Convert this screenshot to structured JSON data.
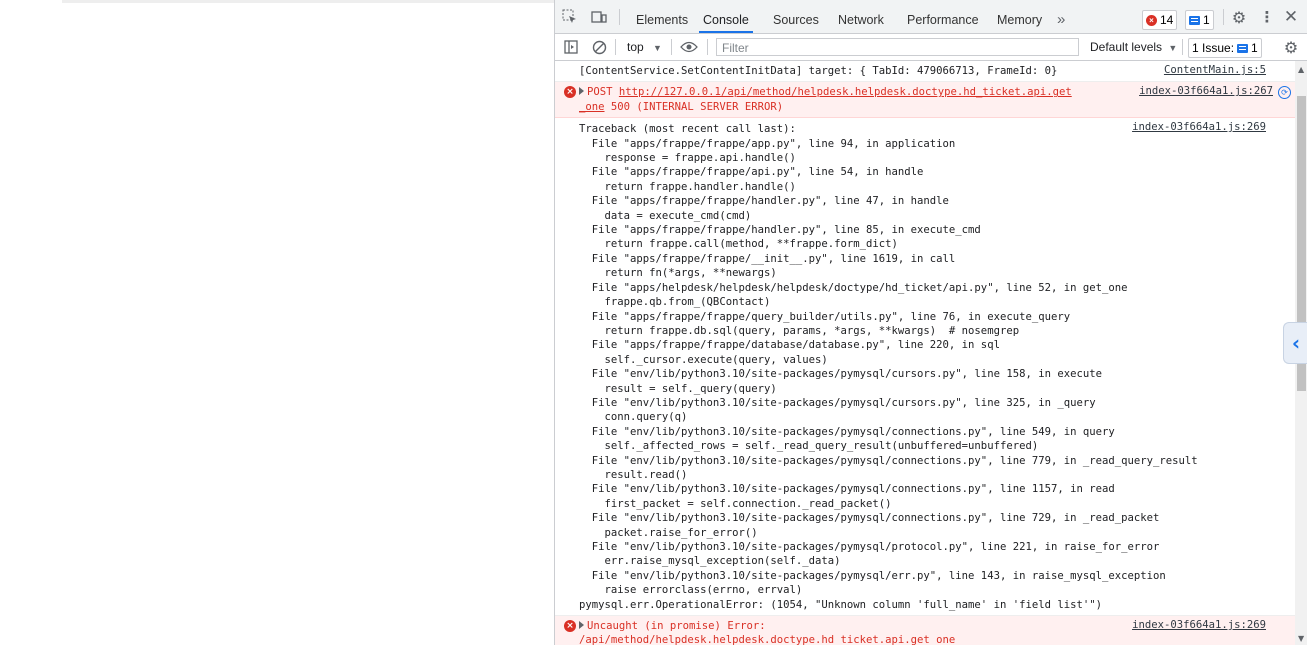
{
  "devtools": {
    "tabs": [
      "Elements",
      "Console",
      "Sources",
      "Network",
      "Performance",
      "Memory"
    ],
    "active_tab": "Console",
    "more_tabs": "»",
    "error_count": "14",
    "message_count": "1",
    "context": "top",
    "filter_placeholder": "Filter",
    "levels": "Default levels",
    "issues_label": "1 Issue:",
    "issues_count": "1"
  },
  "console": {
    "msg1": {
      "text": "[ContentService.SetContentInitData] target: { TabId: 479066713, FrameId: 0}",
      "source": "ContentMain.js:5"
    },
    "msg2": {
      "method": "POST ",
      "url": "http://127.0.0.1/api/method/helpdesk.helpdesk.doctype.hd_ticket.api.get",
      "url_cont": "_one",
      "status": " 500 (INTERNAL SERVER ERROR)",
      "source": "index-03f664a1.js:267"
    },
    "msg3": {
      "source": "index-03f664a1.js:269",
      "lines": [
        "Traceback (most recent call last):",
        "  File \"apps/frappe/frappe/app.py\", line 94, in application",
        "    response = frappe.api.handle()",
        "  File \"apps/frappe/frappe/api.py\", line 54, in handle",
        "    return frappe.handler.handle()",
        "  File \"apps/frappe/frappe/handler.py\", line 47, in handle",
        "    data = execute_cmd(cmd)",
        "  File \"apps/frappe/frappe/handler.py\", line 85, in execute_cmd",
        "    return frappe.call(method, **frappe.form_dict)",
        "  File \"apps/frappe/frappe/__init__.py\", line 1619, in call",
        "    return fn(*args, **newargs)",
        "  File \"apps/helpdesk/helpdesk/helpdesk/doctype/hd_ticket/api.py\", line 52, in get_one",
        "    frappe.qb.from_(QBContact)",
        "  File \"apps/frappe/frappe/query_builder/utils.py\", line 76, in execute_query",
        "    return frappe.db.sql(query, params, *args, **kwargs)  # nosemgrep",
        "  File \"apps/frappe/frappe/database/database.py\", line 220, in sql",
        "    self._cursor.execute(query, values)",
        "  File \"env/lib/python3.10/site-packages/pymysql/cursors.py\", line 158, in execute",
        "    result = self._query(query)",
        "  File \"env/lib/python3.10/site-packages/pymysql/cursors.py\", line 325, in _query",
        "    conn.query(q)",
        "  File \"env/lib/python3.10/site-packages/pymysql/connections.py\", line 549, in query",
        "    self._affected_rows = self._read_query_result(unbuffered=unbuffered)",
        "  File \"env/lib/python3.10/site-packages/pymysql/connections.py\", line 779, in _read_query_result",
        "    result.read()",
        "  File \"env/lib/python3.10/site-packages/pymysql/connections.py\", line 1157, in read",
        "    first_packet = self.connection._read_packet()",
        "  File \"env/lib/python3.10/site-packages/pymysql/connections.py\", line 729, in _read_packet",
        "    packet.raise_for_error()",
        "  File \"env/lib/python3.10/site-packages/pymysql/protocol.py\", line 221, in raise_for_error",
        "    err.raise_mysql_exception(self._data)",
        "  File \"env/lib/python3.10/site-packages/pymysql/err.py\", line 143, in raise_mysql_exception",
        "    raise errorclass(errno, errval)",
        "pymysql.err.OperationalError: (1054, \"Unknown column 'full_name' in 'field list'\")"
      ]
    },
    "msg4": {
      "text": "Uncaught (in promise) Error:",
      "text2": "/api/method/helpdesk.helpdesk.doctype.hd_ticket.api.get_one",
      "source": "index-03f664a1.js:269"
    }
  },
  "colors": {
    "error": "#d93025",
    "accent": "#1a73e8"
  }
}
